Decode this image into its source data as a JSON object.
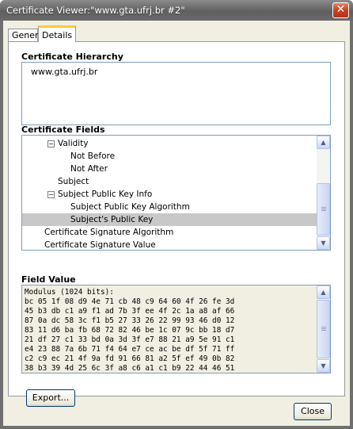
{
  "window": {
    "title": "Certificate Viewer:\"www.gta.ufrj.br #2\"",
    "close_glyph": "✕"
  },
  "tabs": [
    {
      "label": "General",
      "selected": false
    },
    {
      "label": "Details",
      "selected": true
    }
  ],
  "hierarchy": {
    "label": "Certificate Hierarchy",
    "items": [
      "www.gta.ufrj.br"
    ]
  },
  "fields": {
    "label": "Certificate Fields",
    "rows": [
      {
        "label": "Validity",
        "toggle": "−"
      },
      {
        "label": "Not Before"
      },
      {
        "label": "Not After"
      },
      {
        "label": "Subject"
      },
      {
        "label": "Subject Public Key Info",
        "toggle": "−"
      },
      {
        "label": "Subject Public Key Algorithm"
      },
      {
        "label": "Subject's Public Key",
        "selected": true
      },
      {
        "label": "Certificate Signature Algorithm"
      },
      {
        "label": "Certificate Signature Value"
      }
    ]
  },
  "value": {
    "label": "Field Value",
    "lines": [
      "Modulus (1024 bits):",
      "bc 05 1f 08 d9 4e 71 cb 48 c9 64 60 4f 26 fe 3d",
      "45 b3 db c1 a9 f1 ad 7b 3f ee 4f 2c 1a a8 af 66",
      "87 0a dc 58 3c f1 b5 27 33 26 22 99 93 46 d0 12",
      "83 11 d6 ba fb 68 72 82 46 be 1c 07 9c bb 18 d7",
      "21 df 27 c1 33 bd 0a 3d 3f e7 88 21 a9 5e 91 c1",
      "e4 23 88 7a 6b 71 f4 64 e7 ce ac be df 5f 71 ff",
      "c2 c9 ec 21 4f 9a fd 91 66 81 a2 5f ef 49 0b 82",
      "38 b3 39 4d 25 6c 3f a8 c6 a1 c1 b9 22 44 46 51"
    ]
  },
  "buttons": {
    "export": "Export...",
    "close": "Close"
  },
  "scroll_glyphs": {
    "up": "▲",
    "down": "▼"
  }
}
